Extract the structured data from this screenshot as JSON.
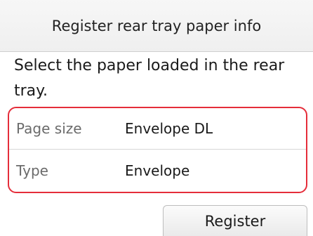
{
  "header": {
    "title": "Register rear tray paper info"
  },
  "instruction": {
    "text": "Select the paper loaded in the rear tray."
  },
  "settings": [
    {
      "label": "Page size",
      "value": "Envelope DL"
    },
    {
      "label": "Type",
      "value": "Envelope"
    }
  ],
  "actions": {
    "register_label": "Register"
  },
  "colors": {
    "highlight_border": "#e52d3a",
    "title_background": "#f2f2f2",
    "label_text": "#6b6b6b"
  }
}
